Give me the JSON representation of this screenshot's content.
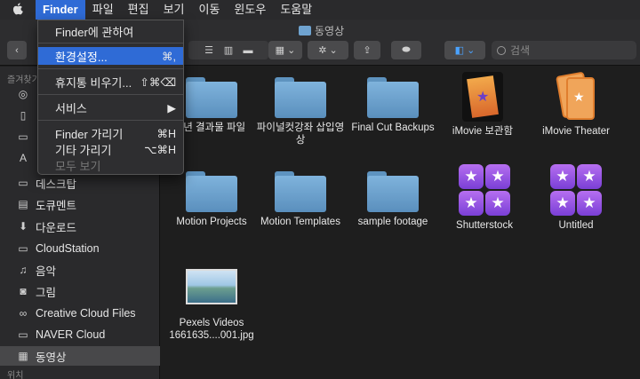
{
  "menubar": {
    "apple": "",
    "items": [
      "Finder",
      "파일",
      "편집",
      "보기",
      "이동",
      "윈도우",
      "도움말"
    ]
  },
  "finder_menu": {
    "about": "Finder에 관하여",
    "preferences": {
      "label": "환경설정...",
      "shortcut": "⌘,"
    },
    "empty_trash": {
      "label": "휴지통 비우기...",
      "shortcut": "⇧⌘⌫"
    },
    "services": {
      "label": "서비스",
      "shortcut": "▶"
    },
    "hide_finder": {
      "label": "Finder 가리기",
      "shortcut": "⌘H"
    },
    "hide_others": {
      "label": "기타 가리기",
      "shortcut": "⌥⌘H"
    },
    "show_all": "모두 보기"
  },
  "window": {
    "title": "동영상",
    "search_placeholder": "검색",
    "back": "‹"
  },
  "sidebar": {
    "header": "즐겨찾기",
    "items": [
      {
        "label": "데스크탑",
        "icon": "desktop-icon",
        "glyph": "▭"
      },
      {
        "label": "도큐멘트",
        "icon": "document-icon",
        "glyph": "▤"
      },
      {
        "label": "다운로드",
        "icon": "download-icon",
        "glyph": "⬇"
      },
      {
        "label": "CloudStation",
        "icon": "folder-icon",
        "glyph": "▭"
      },
      {
        "label": "음악",
        "icon": "music-icon",
        "glyph": "♫"
      },
      {
        "label": "그림",
        "icon": "camera-icon",
        "glyph": "◙"
      },
      {
        "label": "Creative Cloud Files",
        "icon": "creative-cloud-icon",
        "glyph": "∞"
      },
      {
        "label": "NAVER Cloud",
        "icon": "folder-icon",
        "glyph": "▭"
      },
      {
        "label": "동영상",
        "icon": "film-icon",
        "glyph": "▦"
      }
    ],
    "bottom_header": "위치"
  },
  "content": {
    "row1": [
      {
        "label": "8년 결과물 파일",
        "kind": "folder"
      },
      {
        "label": "파이널컷강좌 삽입영상",
        "kind": "folder"
      },
      {
        "label": "Final Cut Backups",
        "kind": "folder"
      },
      {
        "label": "iMovie 보관함",
        "kind": "imovie"
      },
      {
        "label": "iMovie Theater",
        "kind": "theater"
      }
    ],
    "row2": [
      {
        "label": "Motion Projects",
        "kind": "folder"
      },
      {
        "label": "Motion Templates",
        "kind": "folder"
      },
      {
        "label": "sample footage",
        "kind": "folder"
      },
      {
        "label": "Shutterstock",
        "kind": "stars"
      },
      {
        "label": "Untitled",
        "kind": "stars"
      }
    ],
    "row3": [
      {
        "label": "Pexels Videos 1661635....001.jpg",
        "kind": "photo"
      }
    ]
  },
  "colors": {
    "accent": "#2f6bd6",
    "folder": "#6fa3d0"
  }
}
